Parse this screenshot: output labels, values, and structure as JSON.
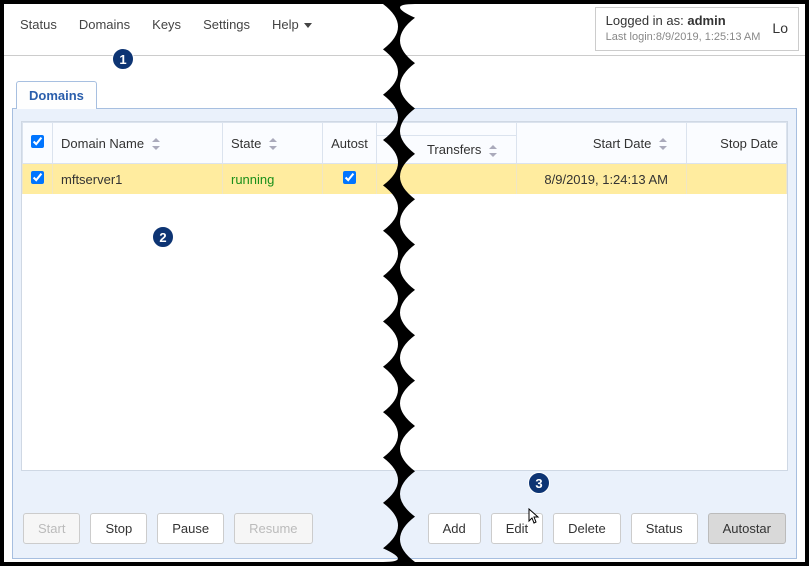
{
  "nav": {
    "status": "Status",
    "domains": "Domains",
    "keys": "Keys",
    "settings": "Settings",
    "help": "Help"
  },
  "login": {
    "prefix": "Logged in as:",
    "user": "admin",
    "last_prefix": "Last login:",
    "last_value": "8/9/2019, 1:25:13 AM",
    "lo": "Lo"
  },
  "tab": {
    "domains": "Domains"
  },
  "columns": {
    "domain_name": "Domain Name",
    "state": "State",
    "autostart": "Autost",
    "transfers": "Transfers",
    "start_date": "Start Date",
    "stop_date": "Stop Date"
  },
  "rows": [
    {
      "domain": "mftserver1",
      "state": "running",
      "autostart": true,
      "start": "8/9/2019, 1:24:13 AM",
      "stop": ""
    }
  ],
  "buttons": {
    "start": "Start",
    "stop": "Stop",
    "pause": "Pause",
    "resume": "Resume",
    "add": "Add",
    "edit": "Edit",
    "delete": "Delete",
    "status": "Status",
    "autostart": "Autostar"
  },
  "badges": {
    "b1": "1",
    "b2": "2",
    "b3": "3"
  }
}
